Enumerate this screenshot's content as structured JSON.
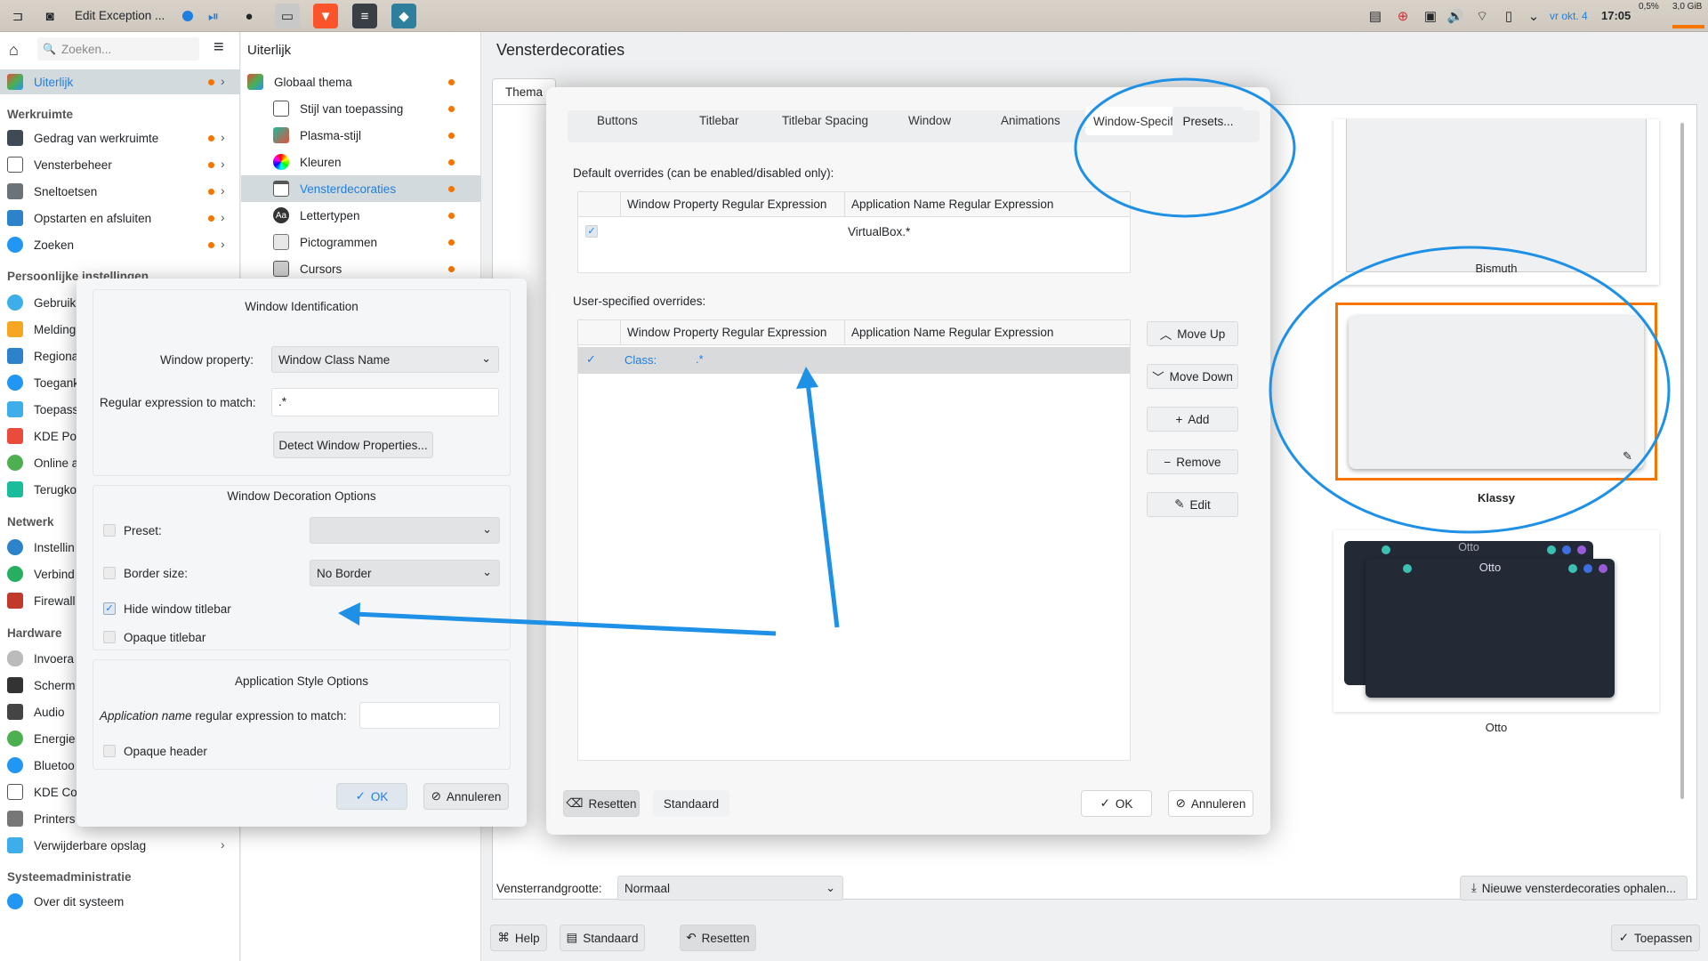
{
  "topbar": {
    "window_title": "Edit Exception ...",
    "cpu": "0,5%",
    "mem": "3,0 GiB",
    "date": "vr okt. 4",
    "time": "17:05"
  },
  "sidebar": {
    "search_placeholder": "Zoeken...",
    "active_item": "Uiterlijk",
    "sections": {
      "werkruimte": "Werkruimte",
      "persoonlijk": "Persoonlijke instellingen",
      "netwerk": "Netwerk",
      "hardware": "Hardware",
      "systeem": "Systeemadministratie"
    },
    "werkruimte_items": [
      "Gedrag van werkruimte",
      "Vensterbeheer",
      "Sneltoetsen",
      "Opstarten en afsluiten",
      "Zoeken"
    ],
    "persoonlijk_items": [
      "Gebruik",
      "Melding",
      "Regiona",
      "Toegank",
      "Toepass",
      "KDE Por",
      "Online a",
      "Terugko"
    ],
    "netwerk_items": [
      "Instellin",
      "Verbind",
      "Firewall"
    ],
    "hardware_items": [
      "Invoera",
      "Scherm",
      "Audio",
      "Energie",
      "Bluetoo",
      "KDE Cor",
      "Printers",
      "Verwijderbare opslag"
    ],
    "systeem_items": [
      "Over dit systeem"
    ]
  },
  "col2": {
    "title": "Uiterlijk",
    "items": [
      "Globaal thema",
      "Stijl van toepassing",
      "Plasma-stijl",
      "Kleuren",
      "Vensterdecoraties",
      "Lettertypen",
      "Pictogrammen",
      "Cursors"
    ]
  },
  "main": {
    "title": "Vensterdecoraties",
    "tab_thema": "Thema",
    "themes": [
      "Bismuth",
      "Klassy",
      "Otto"
    ],
    "otto_title": "Otto",
    "border_size_label": "Vensterrandgrootte:",
    "border_size_value": "Normaal",
    "get_new": "Nieuwe vensterdecoraties ophalen...",
    "help": "Help",
    "standaard": "Standaard",
    "resetten": "Resetten",
    "toepassen": "Toepassen"
  },
  "dialog": {
    "tabs": [
      "Buttons",
      "Titlebar",
      "Titlebar Spacing",
      "Window",
      "Animations",
      "Window-Specifi"
    ],
    "presets": "Presets...",
    "default_label": "Default overrides (can be enabled/disabled only):",
    "user_label": "User-specified overrides:",
    "col_prop": "Window Property Regular Expression",
    "col_app": "Application Name Regular Expression",
    "default_row_app": "VirtualBox.*",
    "user_row_class": "Class:",
    "user_row_regex": ".*",
    "move_up": "Move Up",
    "move_down": "Move Down",
    "add": "Add",
    "remove": "Remove",
    "edit": "Edit",
    "resetten": "Resetten",
    "standaard": "Standaard",
    "ok": "OK",
    "annuleren": "Annuleren"
  },
  "wid": {
    "heading": "Window Identification",
    "window_property_label": "Window property:",
    "window_property_value": "Window Class Name",
    "regex_label": "Regular expression to match:",
    "regex_value": ".*",
    "detect": "Detect Window Properties...",
    "deco_heading": "Window Decoration Options",
    "preset_label": "Preset:",
    "border_size_label": "Border size:",
    "border_size_value": "No Border",
    "hide_titlebar": "Hide window titlebar",
    "opaque_titlebar": "Opaque titlebar",
    "app_heading": "Application Style Options",
    "app_regex_italic": "Application name",
    "app_regex_rest": " regular expression to match:",
    "opaque_header": "Opaque header",
    "ok": "OK",
    "annuleren": "Annuleren"
  },
  "colors": {
    "accent": "#3daee9",
    "orange": "#f67400",
    "annotation": "#1e90e6"
  }
}
